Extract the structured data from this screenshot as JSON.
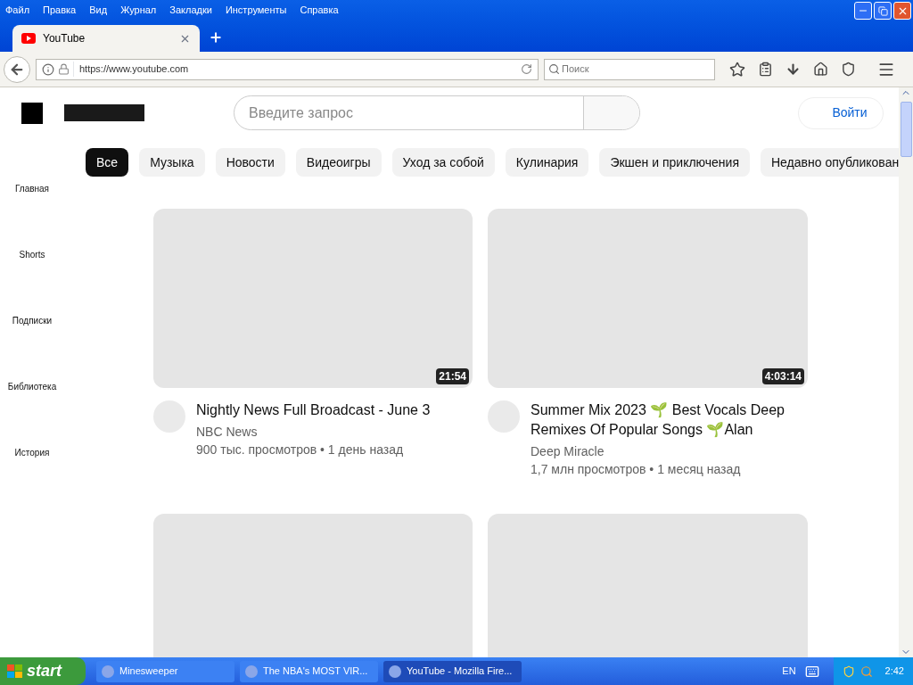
{
  "menu": [
    "Файл",
    "Правка",
    "Вид",
    "Журнал",
    "Закладки",
    "Инструменты",
    "Справка"
  ],
  "tabs": [
    {
      "label": "YouTube",
      "selected": true
    }
  ],
  "address": {
    "value": "https://www.youtube.com"
  },
  "search": {
    "placeholder": "Поиск"
  },
  "page": {
    "search": {
      "placeholder": "Введите запрос"
    },
    "login": "Войти",
    "chips": [
      {
        "label": "Все",
        "selected": true
      },
      {
        "label": "Музыка",
        "selected": false
      },
      {
        "label": "Новости",
        "selected": false
      },
      {
        "label": "Видеоигры",
        "selected": false
      },
      {
        "label": "Уход за собой",
        "selected": false
      },
      {
        "label": "Кулинария",
        "selected": false
      },
      {
        "label": "Экшен и приключения",
        "selected": false
      },
      {
        "label": "Недавно опубликован",
        "selected": false
      }
    ],
    "sidebar": [
      "Главная",
      "Shorts",
      "Подписки",
      "Библиотека",
      "История"
    ],
    "videos": [
      {
        "kind": "full",
        "duration": "21:54",
        "title": "Nightly News Full Broadcast - June 3",
        "channel": "NBC News",
        "meta": "900 тыс. просмотров • 1 день назад"
      },
      {
        "kind": "full",
        "duration": "4:03:14",
        "title": "Summer Mix 2023 🌱 Best Vocals Deep Remixes Of Popular Songs 🌱Alan",
        "channel": "Deep Miracle",
        "meta": "1,7 млн просмотров • 1 месяц назад"
      },
      {
        "kind": "loading"
      },
      {
        "kind": "loading"
      }
    ]
  },
  "taskbar": {
    "start": "start",
    "items": [
      {
        "label": "Minesweeper",
        "selected": false
      },
      {
        "label": "The NBA's MOST VIR...",
        "selected": false
      },
      {
        "label": "YouTube - Mozilla Fire...",
        "selected": true
      }
    ],
    "lang": "EN",
    "clock": "2:42"
  }
}
